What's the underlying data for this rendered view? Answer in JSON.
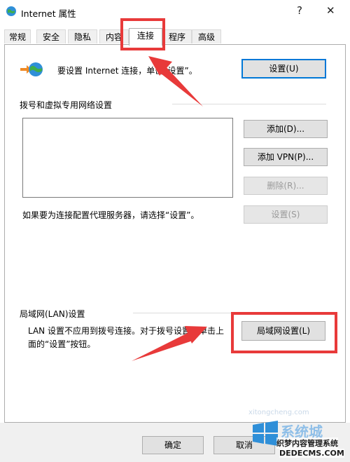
{
  "window": {
    "title": "Internet 属性",
    "help_label": "?",
    "close_label": "✕"
  },
  "tabs": [
    {
      "label": "常规"
    },
    {
      "label": "安全"
    },
    {
      "label": "隐私"
    },
    {
      "label": "内容"
    },
    {
      "label": "连接"
    },
    {
      "label": "程序"
    },
    {
      "label": "高级"
    }
  ],
  "setup": {
    "text": "要设置 Internet 连接，单击“设置”。",
    "button": "设置(U)"
  },
  "dialup": {
    "heading": "拨号和虚拟专用网络设置",
    "add": "添加(D)...",
    "add_vpn": "添加 VPN(P)...",
    "remove": "删除(R)...",
    "proxy_text": "如果要为连接配置代理服务器，请选择“设置”。",
    "settings": "设置(S)"
  },
  "lan": {
    "heading": "局域网(LAN)设置",
    "text_line1": "LAN 设置不应用到拨号连接。对于拨号设置，单击上",
    "text_line2": "面的“设置”按钮。",
    "button": "局域网设置(L)"
  },
  "footer": {
    "ok": "确定",
    "cancel": "取消"
  },
  "watermark": {
    "line1": "织梦内容管理系统",
    "line2": "DEDECMS.COM",
    "brand": "系统城",
    "url": "xitongcheng.com"
  },
  "annotation_color": "#e83a3a"
}
